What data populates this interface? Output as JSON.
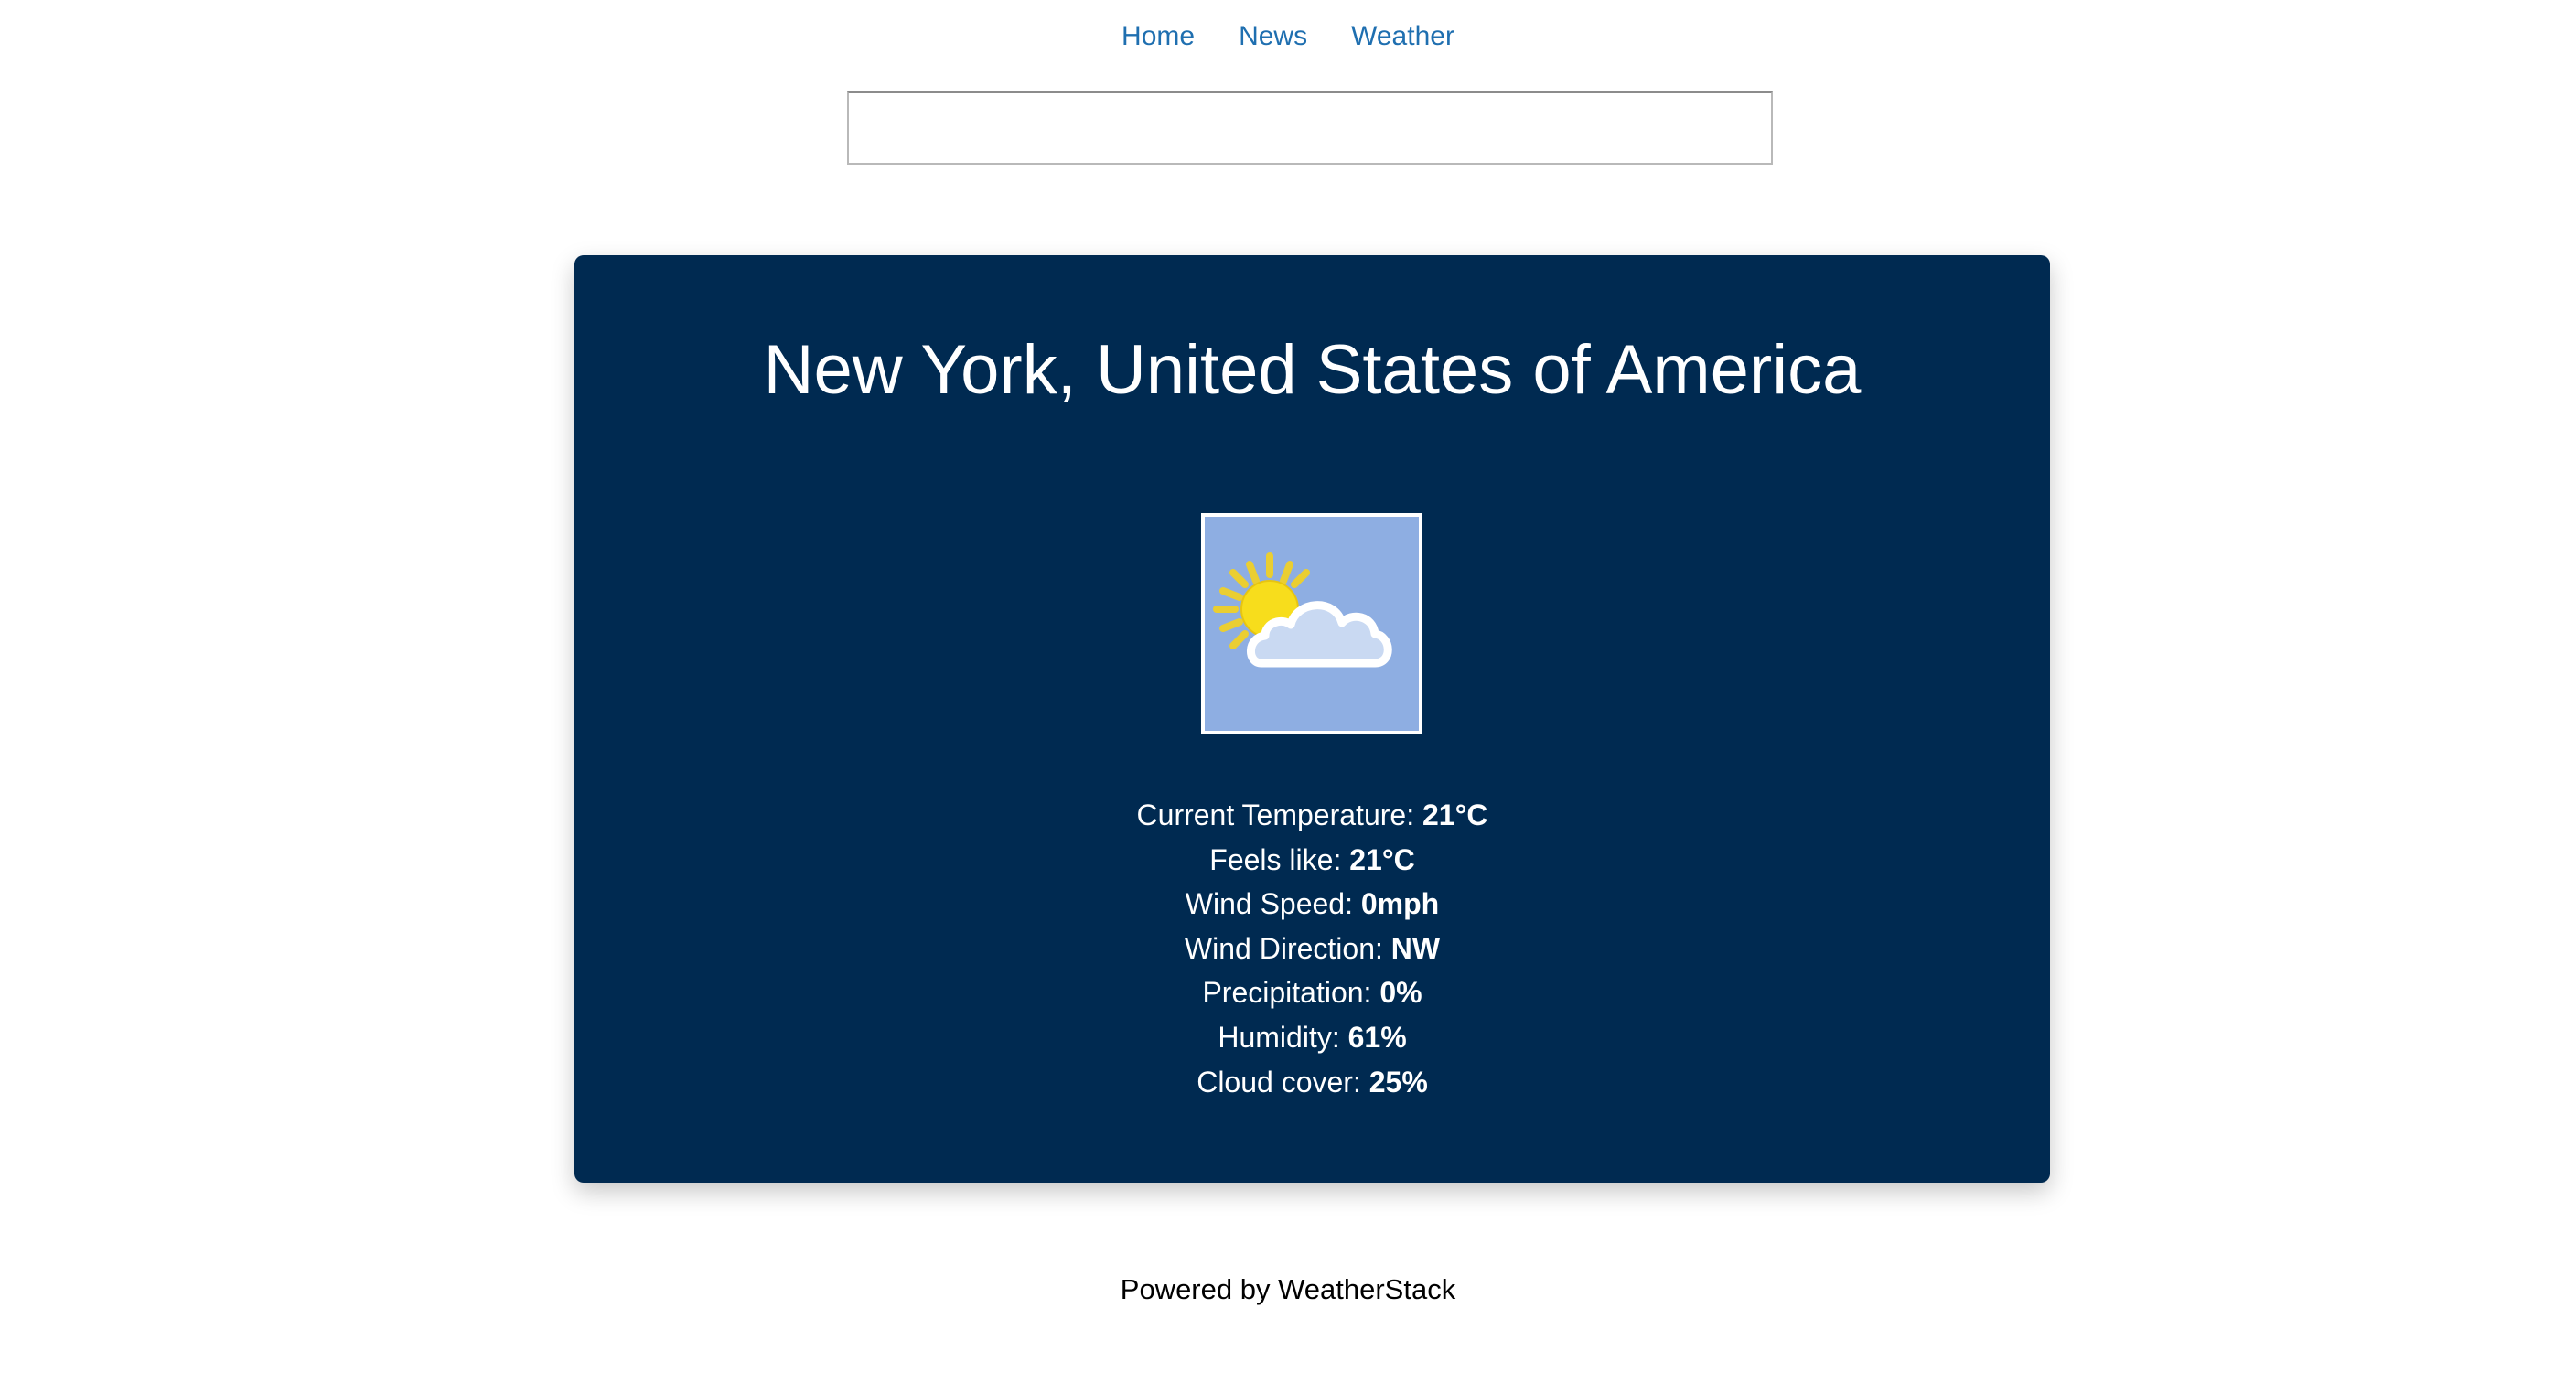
{
  "nav": {
    "items": [
      {
        "label": "Home"
      },
      {
        "label": "News"
      },
      {
        "label": "Weather"
      }
    ]
  },
  "search": {
    "value": "",
    "placeholder": ""
  },
  "weather": {
    "location": "New York, United States of America",
    "icon": "partly-cloudy-icon",
    "details": [
      {
        "label": "Current Temperature:",
        "value": "21°C"
      },
      {
        "label": "Feels like:",
        "value": "21°C"
      },
      {
        "label": "Wind Speed:",
        "value": "0mph"
      },
      {
        "label": "Wind Direction:",
        "value": "NW"
      },
      {
        "label": "Precipitation:",
        "value": "0%"
      },
      {
        "label": "Humidity:",
        "value": "61%"
      },
      {
        "label": "Cloud cover:",
        "value": "25%"
      }
    ]
  },
  "footer": {
    "text": "Powered by WeatherStack"
  },
  "colors": {
    "card_background": "#002a51",
    "link": "#1f6fb0",
    "icon_sky": "#8eaee2"
  }
}
